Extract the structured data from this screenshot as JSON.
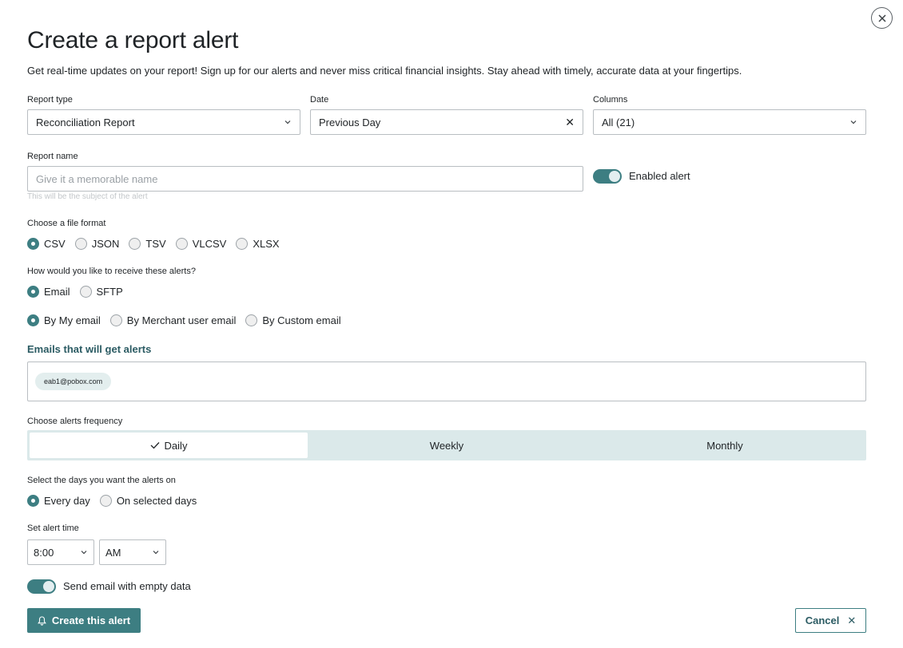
{
  "header": {
    "title": "Create a report alert",
    "subtitle": "Get real-time updates on your report! Sign up for our alerts and never miss critical financial insights. Stay ahead with timely, accurate data at your fingertips."
  },
  "report_type": {
    "label": "Report type",
    "value": "Reconciliation Report"
  },
  "date": {
    "label": "Date",
    "value": "Previous Day"
  },
  "columns": {
    "label": "Columns",
    "value": "All (21)"
  },
  "report_name": {
    "label": "Report name",
    "placeholder": "Give it a memorable name",
    "value": "",
    "helper": "This will be the subject of the alert"
  },
  "enabled_alert": {
    "label": "Enabled alert",
    "on": true
  },
  "file_format": {
    "label": "Choose a file format",
    "options": [
      "CSV",
      "JSON",
      "TSV",
      "VLCSV",
      "XLSX"
    ],
    "selected": "CSV"
  },
  "delivery": {
    "label": "How would you like to receive these alerts?",
    "options": [
      "Email",
      "SFTP"
    ],
    "selected": "Email"
  },
  "email_source": {
    "options": [
      "By My email",
      "By Merchant user email",
      "By Custom email"
    ],
    "selected": "By My email"
  },
  "emails": {
    "title": "Emails that will get alerts",
    "list": [
      "eab1@pobox.com"
    ]
  },
  "frequency": {
    "label": "Choose alerts frequency",
    "options": [
      "Daily",
      "Weekly",
      "Monthly"
    ],
    "selected": "Daily"
  },
  "days": {
    "label": "Select the days you want the alerts on",
    "options": [
      "Every day",
      "On selected days"
    ],
    "selected": "Every day"
  },
  "alert_time": {
    "label": "Set alert time",
    "time": "8:00",
    "period": "AM"
  },
  "empty_data": {
    "label": "Send email with empty data",
    "on": true
  },
  "actions": {
    "create": "Create this alert",
    "cancel": "Cancel"
  },
  "colors": {
    "accent": "#3d7e82",
    "accent_light": "#dbe9ea",
    "heading_teal": "#2b5b63"
  }
}
